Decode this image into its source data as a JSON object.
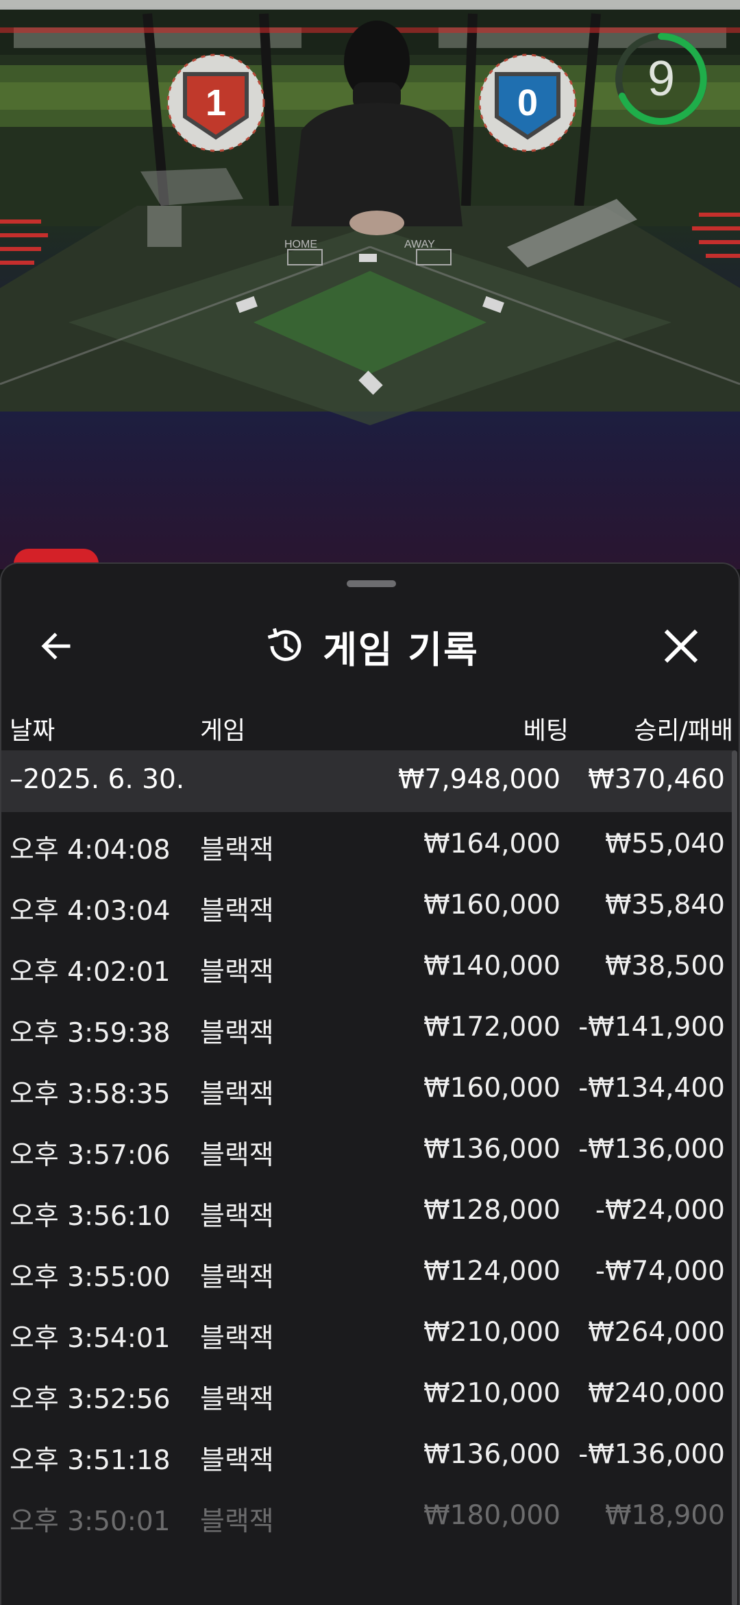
{
  "game_view": {
    "countdown": "9",
    "home_score": "1",
    "away_score": "0",
    "home_label": "HOME",
    "away_label": "AWAY"
  },
  "sheet": {
    "title": "게임 기록",
    "icons": {
      "back": "arrow-left-icon",
      "history": "history-icon",
      "close": "close-icon"
    },
    "columns": {
      "date": "날짜",
      "game": "게임",
      "bet": "베팅",
      "win_loss": "승리/패배"
    },
    "day_summary": {
      "date": "–2025. 6. 30.",
      "bet": "₩7,948,000",
      "win_loss": "₩370,460"
    },
    "rows": [
      {
        "time": "오후 4:04:08",
        "game": "블랙잭",
        "bet": "₩164,000",
        "win_loss": "₩55,040"
      },
      {
        "time": "오후 4:03:04",
        "game": "블랙잭",
        "bet": "₩160,000",
        "win_loss": "₩35,840"
      },
      {
        "time": "오후 4:02:01",
        "game": "블랙잭",
        "bet": "₩140,000",
        "win_loss": "₩38,500"
      },
      {
        "time": "오후 3:59:38",
        "game": "블랙잭",
        "bet": "₩172,000",
        "win_loss": "-₩141,900"
      },
      {
        "time": "오후 3:58:35",
        "game": "블랙잭",
        "bet": "₩160,000",
        "win_loss": "-₩134,400"
      },
      {
        "time": "오후 3:57:06",
        "game": "블랙잭",
        "bet": "₩136,000",
        "win_loss": "-₩136,000"
      },
      {
        "time": "오후 3:56:10",
        "game": "블랙잭",
        "bet": "₩128,000",
        "win_loss": "-₩24,000"
      },
      {
        "time": "오후 3:55:00",
        "game": "블랙잭",
        "bet": "₩124,000",
        "win_loss": "-₩74,000"
      },
      {
        "time": "오후 3:54:01",
        "game": "블랙잭",
        "bet": "₩210,000",
        "win_loss": "₩264,000"
      },
      {
        "time": "오후 3:52:56",
        "game": "블랙잭",
        "bet": "₩210,000",
        "win_loss": "₩240,000"
      },
      {
        "time": "오후 3:51:18",
        "game": "블랙잭",
        "bet": "₩136,000",
        "win_loss": "-₩136,000"
      },
      {
        "time": "오후 3:50:01",
        "game": "블랙잭",
        "bet": "₩180,000",
        "win_loss": "₩18,900"
      }
    ]
  }
}
